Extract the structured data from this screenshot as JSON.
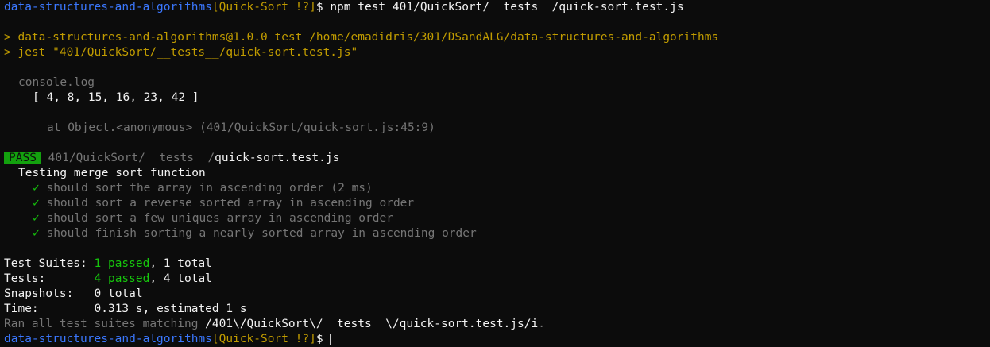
{
  "prompt": {
    "dir": "data-structures-and-algorithms",
    "branch": "[Quick-Sort !?]",
    "symbol": "$",
    "command": "npm test 401/QuickSort/__tests__/quick-sort.test.js"
  },
  "npm_header": {
    "line1": "> data-structures-and-algorithms@1.0.0 test /home/emadidris/301/DSandALG/data-structures-and-algorithms",
    "line2": "> jest \"401/QuickSort/__tests__/quick-sort.test.js\""
  },
  "console": {
    "label": "console.log",
    "output": "[ 4, 8, 15, 16, 23, 42 ]",
    "location": "at Object.<anonymous> (401/QuickSort/quick-sort.js:45:9)"
  },
  "result": {
    "status": "PASS",
    "path_dir": "401/QuickSort/__tests__/",
    "path_file": "quick-sort.test.js",
    "suite_name": "Testing merge sort function",
    "check": "✓",
    "tests": [
      "should sort the array in ascending order (2 ms)",
      "should sort a reverse sorted array in ascending order",
      "should sort a few uniques array in ascending order",
      "should finish sorting a nearly sorted array in ascending order"
    ]
  },
  "summary": {
    "suites_label": "Test Suites:",
    "suites_passed": "1 passed",
    "suites_total": ", 1 total",
    "tests_label": "Tests:",
    "tests_passed": "4 passed",
    "tests_total": ", 4 total",
    "snapshots_label": "Snapshots:",
    "snapshots_value": "0 total",
    "time_label": "Time:",
    "time_value": "0.313 s, estimated 1 s",
    "ran_prefix": "Ran all test suites matching ",
    "ran_pattern": "/401\\/QuickSort\\/__tests__\\/quick-sort.test.js/i",
    "ran_suffix": "."
  },
  "colors": {
    "background": "#0c0c0c",
    "prompt_dir": "#3b78ff",
    "prompt_branch": "#c19c00",
    "pass_badge": "#13a10e",
    "passed_text": "#16c60c"
  }
}
